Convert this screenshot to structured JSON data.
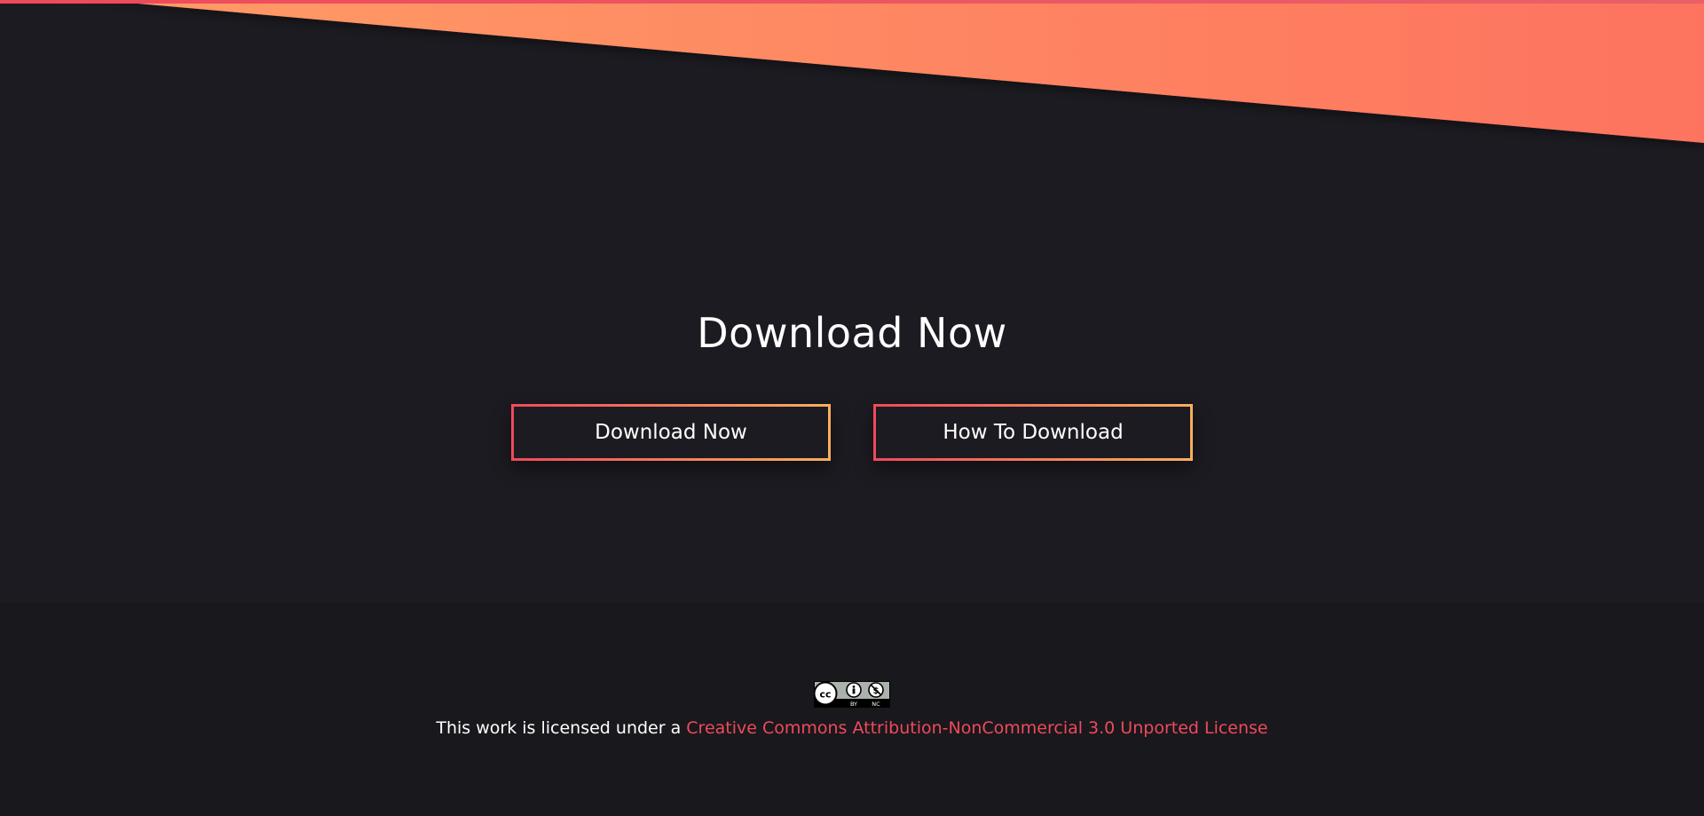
{
  "main": {
    "title": "Download Now",
    "buttons": {
      "download_label": "Download Now",
      "how_to_label": "How To Download"
    }
  },
  "footer": {
    "badge": {
      "icon": "creative-commons-by-nc-badge",
      "by_label": "BY",
      "nc_label": "NC"
    },
    "license_prefix": "This work is licensed under a ",
    "license_link_text": "Creative Commons Attribution-NonCommercial 3.0 Unported License"
  },
  "colors": {
    "background": "#1c1b21",
    "footer_background": "#19181d",
    "accent_start": "#ef4a5b",
    "accent_end": "#fbae5f",
    "banner_start": "#ff9b66",
    "banner_end": "#fd735f",
    "text": "#ffffff"
  }
}
